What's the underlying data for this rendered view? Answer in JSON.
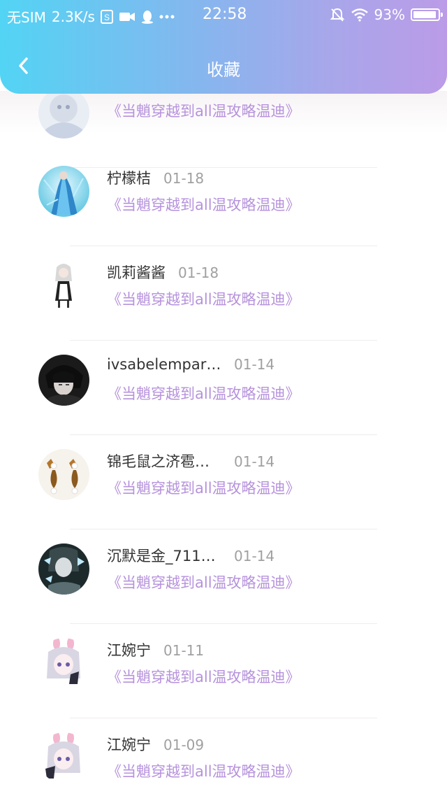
{
  "status_bar": {
    "carrier": "无SIM",
    "speed": "2.3K/s",
    "time": "22:58",
    "battery_percent": "93%",
    "battery_level": 0.93,
    "icons": [
      "sim-card-icon",
      "video-icon",
      "qq-penguin-icon",
      "more-dots-icon",
      "silent-bell-icon",
      "wifi-icon",
      "battery-icon"
    ]
  },
  "header": {
    "title": "收藏",
    "back_icon": "chevron-left-icon",
    "gradient": [
      "#52d4f4",
      "#bb9be8"
    ]
  },
  "colors": {
    "link": "#b692dc",
    "name": "#333333",
    "date": "#a0a0a0"
  },
  "favorites": [
    {
      "name": "",
      "date": "",
      "book": "《当魈穿越到all温攻略温迪》",
      "avatar": "anime-character-avatar"
    },
    {
      "name": "柠檬桔",
      "date": "01-18",
      "book": "《当魈穿越到all温攻略温迪》",
      "avatar": "blue-dress-character-avatar"
    },
    {
      "name": "凯莉酱酱",
      "date": "01-18",
      "book": "《当魈穿越到all温攻略温迪》",
      "avatar": "maid-character-avatar"
    },
    {
      "name": "ivsabelempar…",
      "date": "01-14",
      "book": "《当魈穿越到all温攻略温迪》",
      "avatar": "dark-haired-boy-avatar"
    },
    {
      "name": "锦毛鼠之济雹…",
      "date": "01-14",
      "book": "《当魈穿越到all温攻略温迪》",
      "avatar": "pearl-earrings-avatar"
    },
    {
      "name": "沉默是金_711…",
      "date": "01-14",
      "book": "《当魈穿越到all温攻略温迪》",
      "avatar": "butterfly-character-avatar"
    },
    {
      "name": "江婉宁",
      "date": "01-11",
      "book": "《当魈穿越到all温攻略温迪》",
      "avatar": "bunny-ears-girl-avatar"
    },
    {
      "name": "江婉宁",
      "date": "01-09",
      "book": "《当魈穿越到all温攻略温迪》",
      "avatar": "bunny-ears-girl-avatar"
    }
  ]
}
